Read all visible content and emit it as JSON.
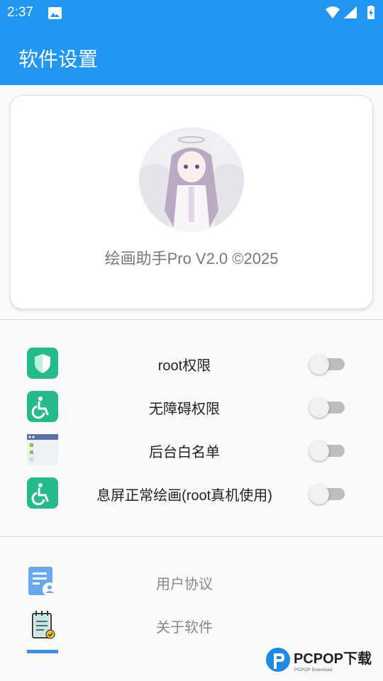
{
  "status_bar": {
    "time": "2:37"
  },
  "app_bar": {
    "title": "软件设置"
  },
  "profile": {
    "version_text": "绘画助手Pro V2.0 ©2025"
  },
  "permissions": [
    {
      "label": "root权限",
      "enabled": false,
      "icon": "shield-icon"
    },
    {
      "label": "无障碍权限",
      "enabled": false,
      "icon": "accessibility-icon"
    },
    {
      "label": "后台白名单",
      "enabled": false,
      "icon": "app-list-icon"
    },
    {
      "label": "息屏正常绘画(root真机使用)",
      "enabled": false,
      "icon": "accessibility-icon"
    }
  ],
  "links": [
    {
      "label": "用户协议",
      "icon": "user-agreement-icon"
    },
    {
      "label": "关于软件",
      "icon": "about-notepad-icon"
    }
  ],
  "watermark": {
    "brand": "PCPOP下载",
    "sub": "PCPOP Download"
  },
  "colors": {
    "primary": "#2196f3",
    "accent_green": "#26b98b",
    "switch_off": "#bdbdbd"
  }
}
